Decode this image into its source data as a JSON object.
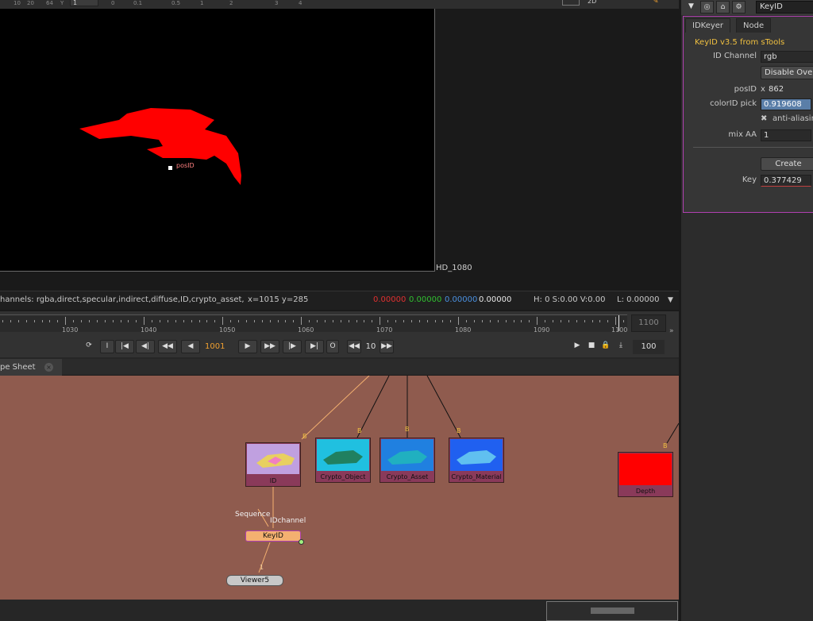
{
  "viewer": {
    "ruler_labels": [
      "10",
      "20",
      "64",
      "Y",
      "1",
      "0",
      "0.1",
      "0.5",
      "1",
      "2",
      "3",
      "4"
    ],
    "mode_label": "2D",
    "format_label": "HD_1080",
    "info": {
      "channels": "hannels: rgba,direct,specular,indirect,diffuse,ID,crypto_asset,",
      "coords": "x=1015 y=285",
      "r": "0.00000",
      "g": "0.00000",
      "b": "0.00000",
      "a": "0.00000",
      "hsv": "H:  0 S:0.00 V:0.00",
      "lum": "L: 0.00000"
    },
    "overlay_label": "posID",
    "colors": {
      "matte": "#ff0000",
      "r": "#e03030",
      "g": "#30c030",
      "b": "#4a90e0",
      "a": "#e8e8e8"
    }
  },
  "timeline": {
    "labels": [
      "1030",
      "1040",
      "1050",
      "1060",
      "1070",
      "1080",
      "1090",
      "1100"
    ],
    "end_frame": "1100",
    "current_frame": "1001",
    "step": "10",
    "fps": "100",
    "buttons": {
      "first": "|◀",
      "prev_key": "◀|",
      "back": "◀◀",
      "play_back": "◀",
      "play": "▶",
      "fwd": "▶▶",
      "next_key": "|▶",
      "last": "▶|",
      "loop": "O",
      "step_back": "◀◀",
      "step_fwd": "▶▶"
    }
  },
  "dag": {
    "tab_label": "pe Sheet",
    "tab_close": "×",
    "nodes": {
      "id": {
        "label": "ID",
        "input": "B"
      },
      "crypto_object": {
        "label": "Crypto_Object",
        "input": "B"
      },
      "crypto_asset": {
        "label": "Crypto_Asset",
        "input": "B"
      },
      "crypto_material": {
        "label": "Crypto_Material",
        "input": "B"
      },
      "depth": {
        "label": "Depth",
        "input": "B"
      },
      "keyid": {
        "label": "KeyID"
      },
      "viewer5": {
        "label": "Viewer5",
        "input": "1"
      }
    },
    "pipe_labels": {
      "sequence": "Sequence",
      "idchannel": "IDchannel"
    },
    "colors": {
      "background": "#8f5b4e",
      "keyid_node": "#f4b070",
      "depth_thumb": "#ff0000"
    }
  },
  "props": {
    "node_name": "KeyID",
    "tabs": [
      "IDKeyer",
      "Node"
    ],
    "title": "KeyID v3.5 from sTools",
    "id_channel_label": "ID Channel",
    "id_channel_value": "rgb",
    "disable_button": "Disable Over",
    "posid_label": "posID",
    "posid_x_label": "x",
    "posid_x_value": "862",
    "colorid_label": "colorID pick",
    "colorid_value": "0.919608",
    "antialias_label": "anti-aliasin",
    "mixaa_label": "mix AA",
    "mixaa_value": "1",
    "create_button": "Create",
    "key_label": "Key",
    "key_value": "0.377429",
    "colors": {
      "title": "#f0c040",
      "border": "#b040b0"
    }
  }
}
